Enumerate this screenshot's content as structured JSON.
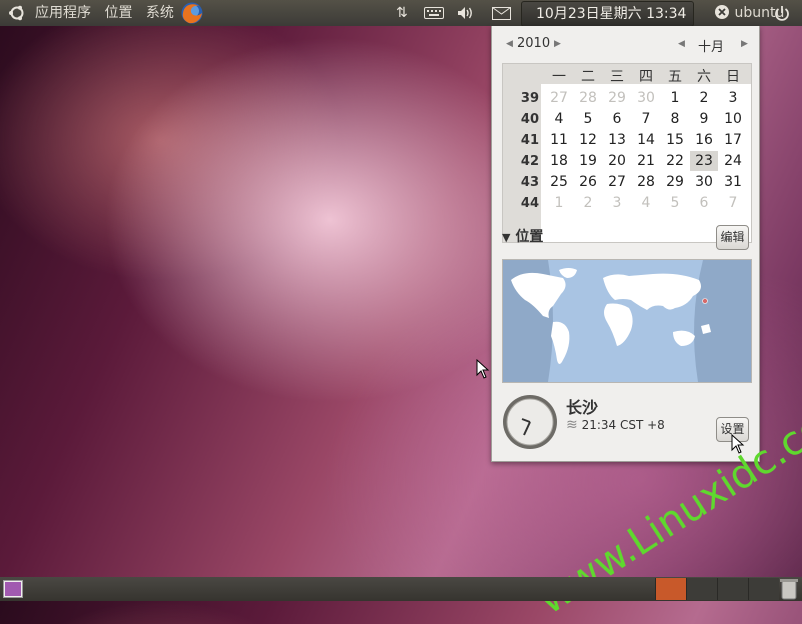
{
  "top_panel": {
    "menu": {
      "applications": "应用程序",
      "places": "位置",
      "system": "系统"
    },
    "clock": "10月23日星期六 13:34",
    "user": "ubuntu"
  },
  "calendar": {
    "year": "2010",
    "month": "十月",
    "weekdays": [
      "一",
      "二",
      "三",
      "四",
      "五",
      "六",
      "日"
    ],
    "weeks": [
      {
        "week": "39",
        "days": [
          "27",
          "28",
          "29",
          "30",
          "1",
          "2",
          "3"
        ]
      },
      {
        "week": "40",
        "days": [
          "4",
          "5",
          "6",
          "7",
          "8",
          "9",
          "10"
        ]
      },
      {
        "week": "41",
        "days": [
          "11",
          "12",
          "13",
          "14",
          "15",
          "16",
          "17"
        ]
      },
      {
        "week": "42",
        "days": [
          "18",
          "19",
          "20",
          "21",
          "22",
          "23",
          "24"
        ]
      },
      {
        "week": "43",
        "days": [
          "25",
          "26",
          "27",
          "28",
          "29",
          "30",
          "31"
        ]
      },
      {
        "week": "44",
        "days": [
          "1",
          "2",
          "3",
          "4",
          "5",
          "6",
          "7"
        ]
      }
    ],
    "today": "23"
  },
  "location": {
    "header": "位置",
    "edit_button": "编辑",
    "city": "长沙",
    "time_text": "21:34 CST +8",
    "settings_button": "设置"
  },
  "watermark": "www.Linuxidc.com",
  "colors": {
    "panel": "#3c3b37",
    "workspace_active": "#c8592a",
    "watermark": "#5fd82e"
  }
}
